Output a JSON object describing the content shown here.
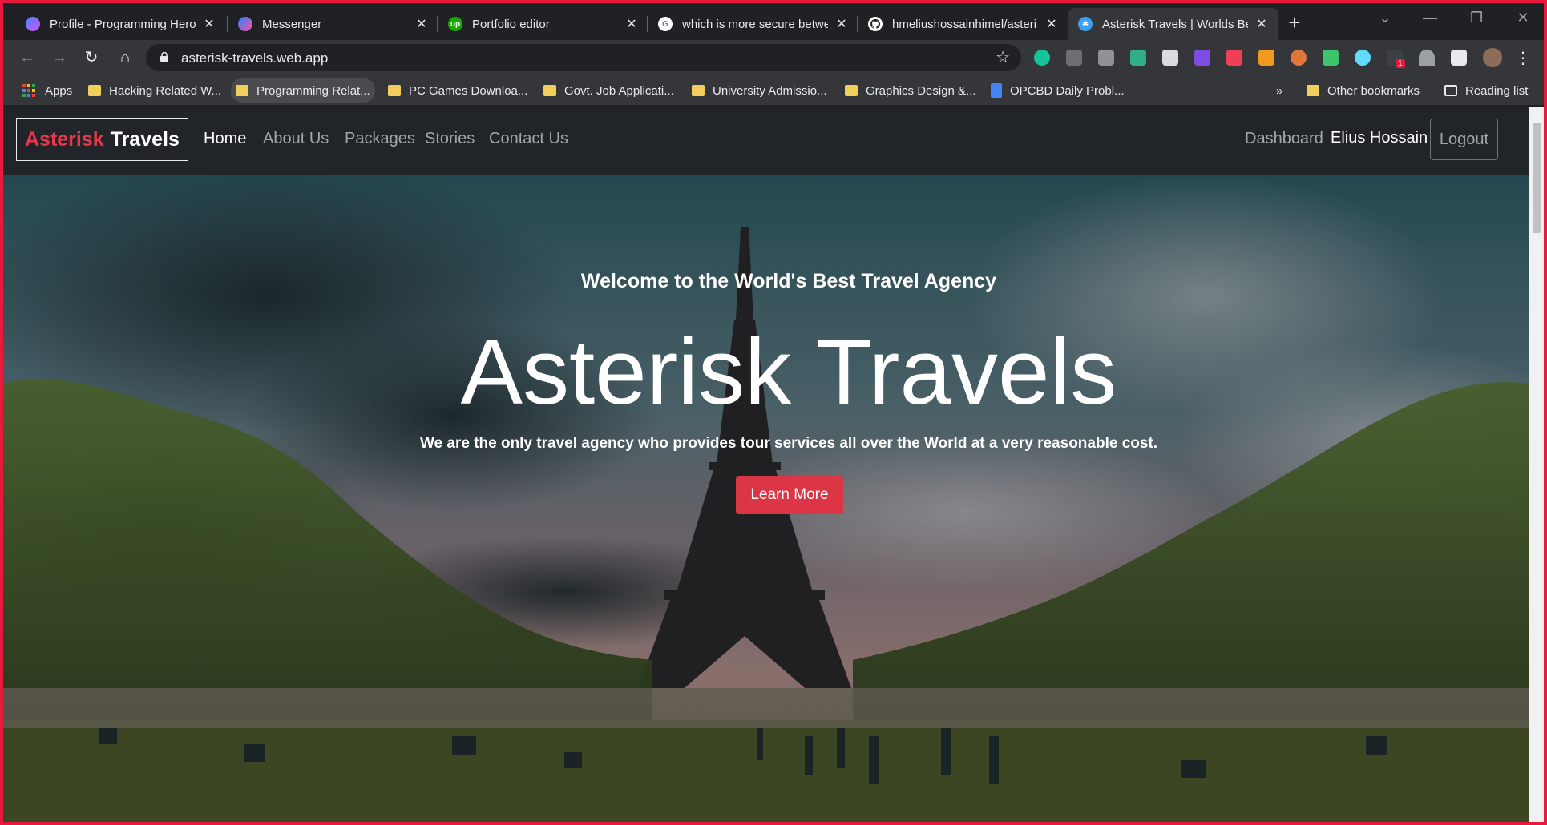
{
  "browser": {
    "tabs": [
      {
        "title": "Profile - Programming Hero",
        "favicon": "programming-hero-icon",
        "color": "#8a4cf0"
      },
      {
        "title": "Messenger",
        "favicon": "messenger-icon",
        "color": "#7b5cff"
      },
      {
        "title": "Portfolio editor",
        "favicon": "upwork-icon",
        "color": "#14a800"
      },
      {
        "title": "which is more secure betwe",
        "favicon": "google-icon",
        "color": "#4285f4"
      },
      {
        "title": "hmeliushossainhimel/asteri",
        "favicon": "github-icon",
        "color": "#ffffff"
      },
      {
        "title": "Asterisk Travels | Worlds Be",
        "favicon": "asterisk-icon",
        "color": "#3aa0f0"
      }
    ],
    "new_tab": "+",
    "url": "asterisk-travels.web.app",
    "bookmarks": {
      "apps_label": "Apps",
      "items": [
        "Hacking Related W...",
        "Programming Relat...",
        "PC Games Downloa...",
        "Govt. Job Applicati...",
        "University Admissio...",
        "Graphics Design &...",
        "OPCBD Daily Probl..."
      ],
      "overflow": "»",
      "other": "Other bookmarks",
      "reading_list": "Reading list"
    },
    "extension_badge": "1"
  },
  "site": {
    "brand_first": "Asterisk",
    "brand_second": "Travels",
    "nav": [
      "Home",
      "About Us",
      "Packages",
      "Stories",
      "Contact Us"
    ],
    "dashboard": "Dashboard",
    "user_name": "Elius Hossain",
    "logout": "Logout"
  },
  "hero": {
    "welcome": "Welcome to the World's Best Travel Agency",
    "title": "Asterisk Travels",
    "tagline": "We are the only travel agency who provides tour services all over the World at a very reasonable cost.",
    "button": "Learn More"
  },
  "colors": {
    "accent_red": "#dc3545",
    "brand_red": "#e8364b",
    "nav_bg": "#212529"
  }
}
